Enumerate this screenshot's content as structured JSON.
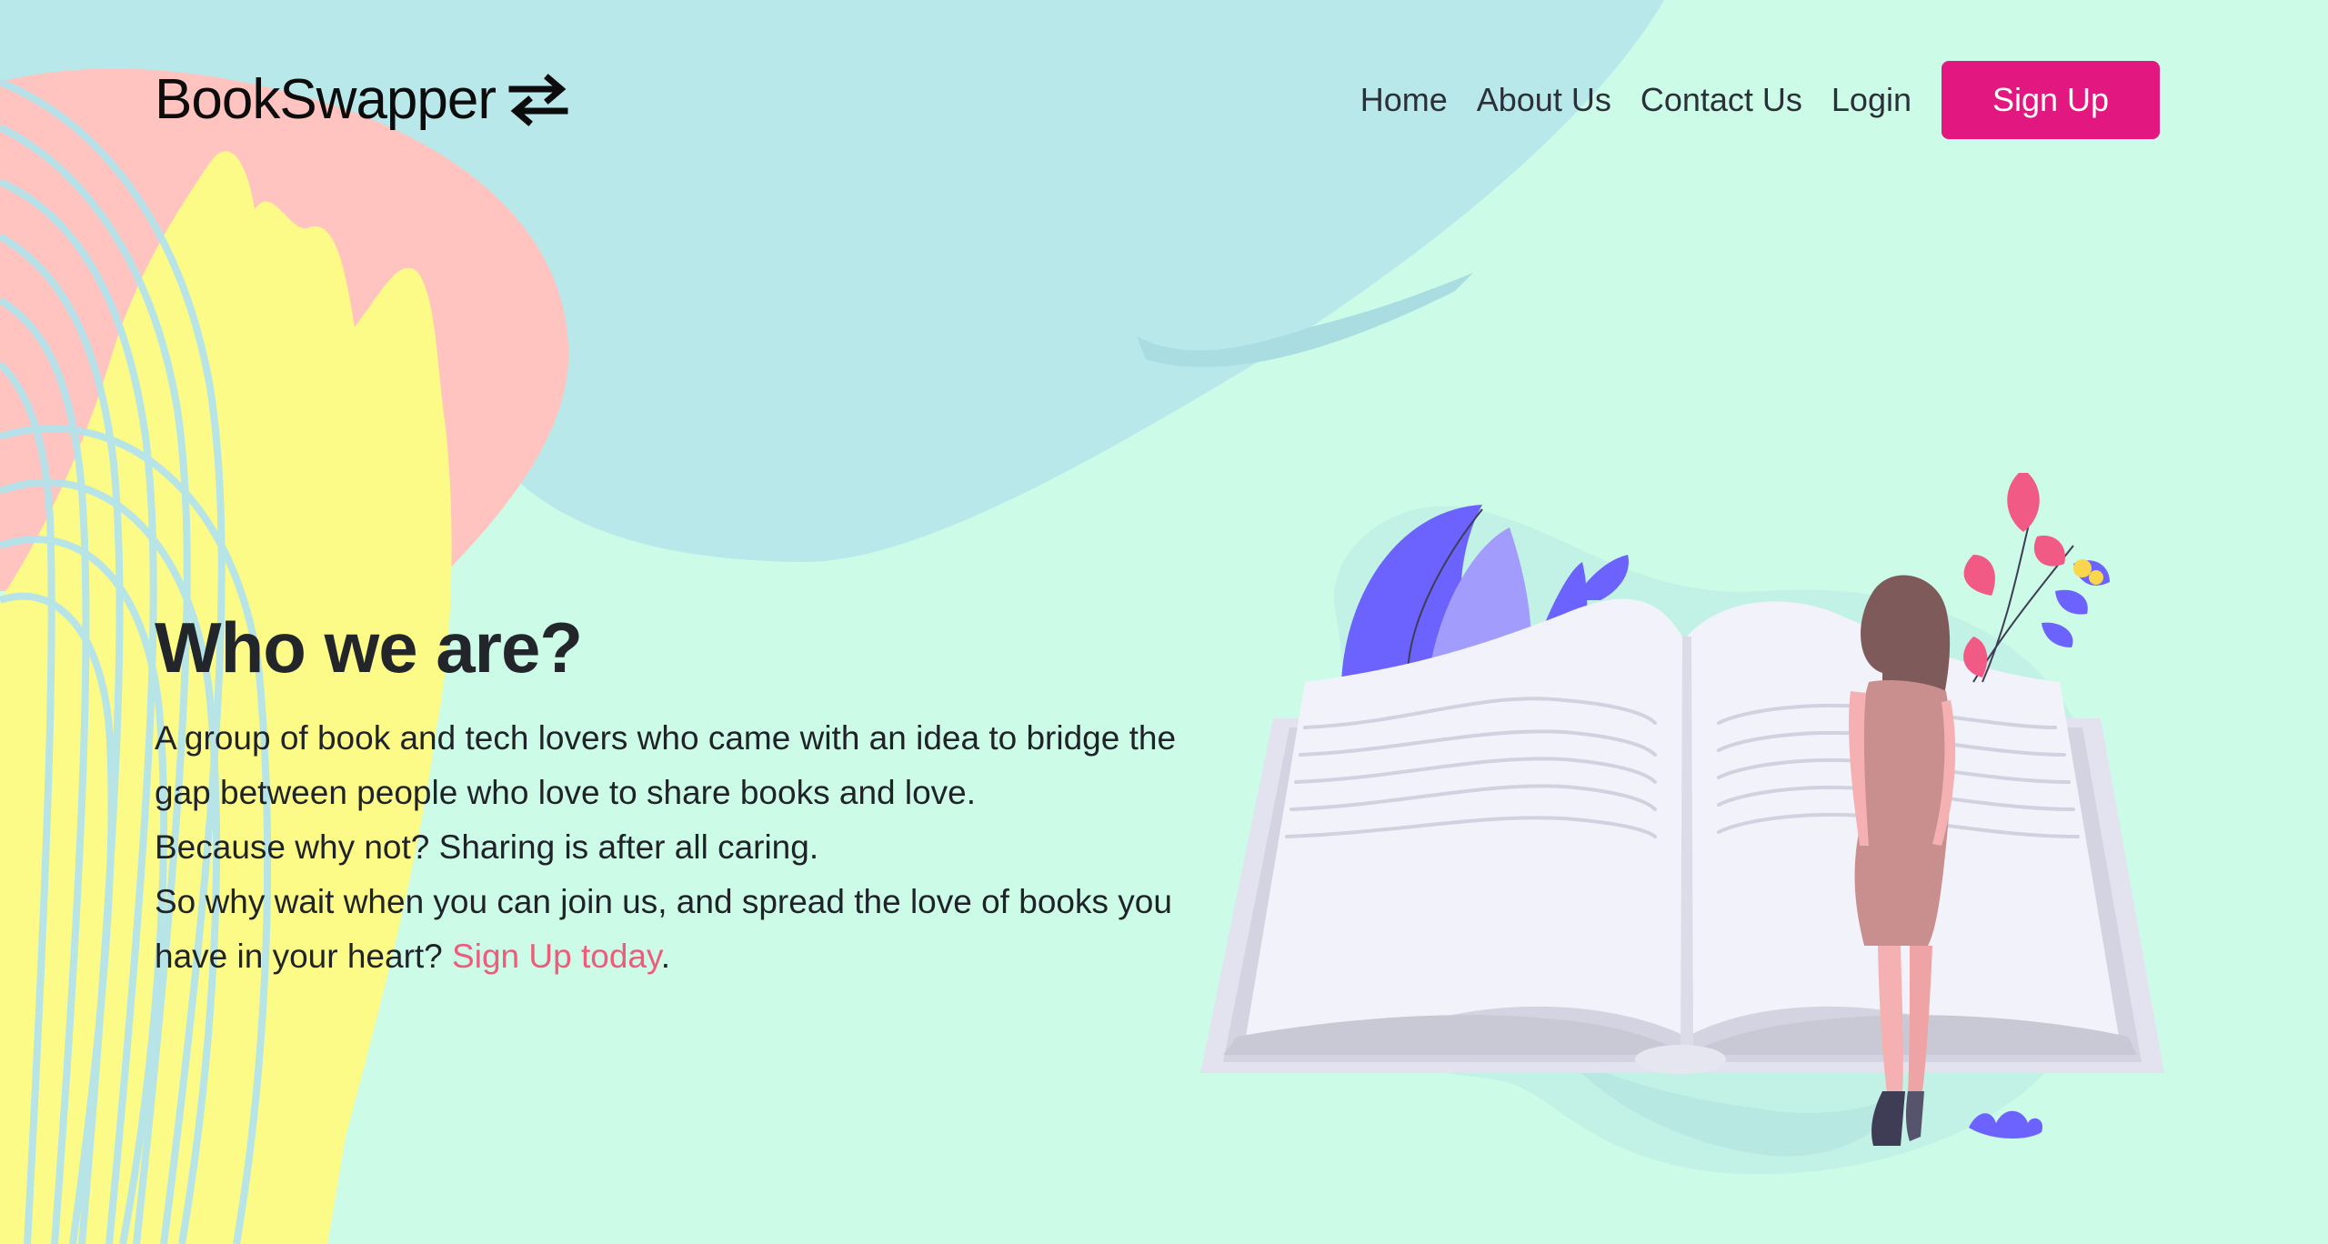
{
  "header": {
    "brand": "BookSwapper",
    "brand_icon": "swap-arrows-icon",
    "nav": [
      {
        "label": "Home"
      },
      {
        "label": "About Us"
      },
      {
        "label": "Contact Us"
      },
      {
        "label": "Login"
      }
    ],
    "signup_label": "Sign Up"
  },
  "hero": {
    "title": "Who we are?",
    "paragraph1": "A group of book and tech lovers who came with an idea to bridge the gap between people who love to share books and love.",
    "paragraph2": "Because why not? Sharing is after all caring.",
    "paragraph3": "So why wait when you can join us, and spread the love of books you have in your heart?",
    "signup_link": "Sign Up today",
    "suffix": "."
  },
  "colors": {
    "background": "#ccfbe7",
    "accent": "#e2177f",
    "link": "#ee5c7c",
    "blob_blue": "#b9e8ea",
    "blob_pink": "#ffc4c0",
    "blob_yellow": "#fdfb87",
    "illustration_purple": "#6c63ff"
  }
}
